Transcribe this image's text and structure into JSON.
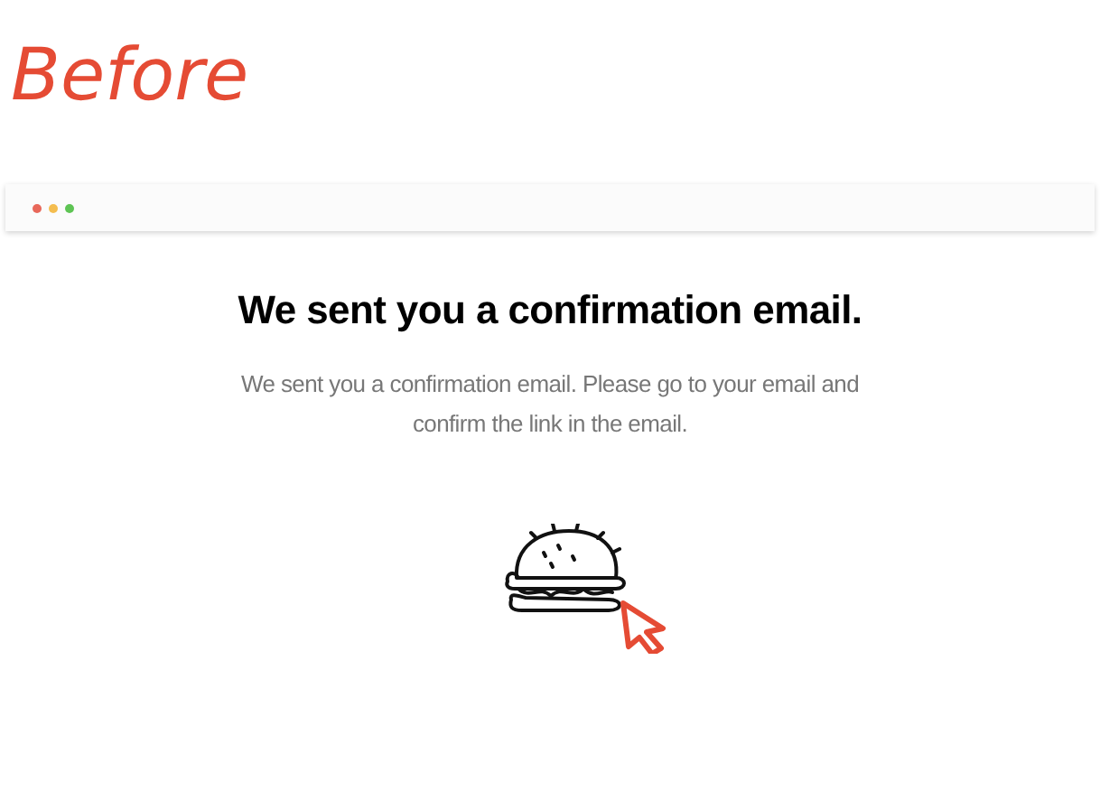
{
  "label": "Before",
  "browser": {
    "window_controls": [
      {
        "color": "#e8685a"
      },
      {
        "color": "#f4bd4f"
      },
      {
        "color": "#5ec454"
      }
    ]
  },
  "page": {
    "heading": "We sent you a confirmation email.",
    "message": "We sent you a confirmation email. Please go to your email and confirm the link in the email."
  }
}
